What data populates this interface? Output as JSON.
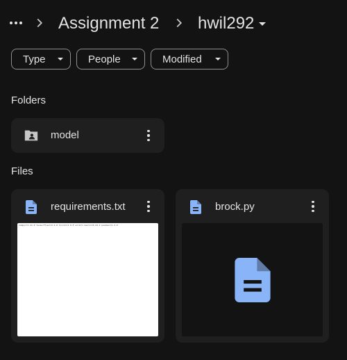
{
  "breadcrumb": {
    "parent": "Assignment 2",
    "current": "hwil292"
  },
  "filters": [
    {
      "label": "Type"
    },
    {
      "label": "People"
    },
    {
      "label": "Modified"
    }
  ],
  "sections": {
    "folders_title": "Folders",
    "files_title": "Files"
  },
  "folders": [
    {
      "name": "model",
      "icon": "shared-folder-icon"
    }
  ],
  "files": [
    {
      "name": "requirements.txt",
      "icon": "doc-icon",
      "preview_text": "numpy==1.21.0 tensorflow==2.6.0 torch==1.9.0 scikit-learn==0.24.2 pandas==1.3.0"
    },
    {
      "name": "brock.py",
      "icon": "doc-icon"
    }
  ],
  "colors": {
    "background": "#131313",
    "card": "#1f1f1f",
    "doc_icon": "#8ab4f8",
    "text": "#e3e3e3"
  }
}
